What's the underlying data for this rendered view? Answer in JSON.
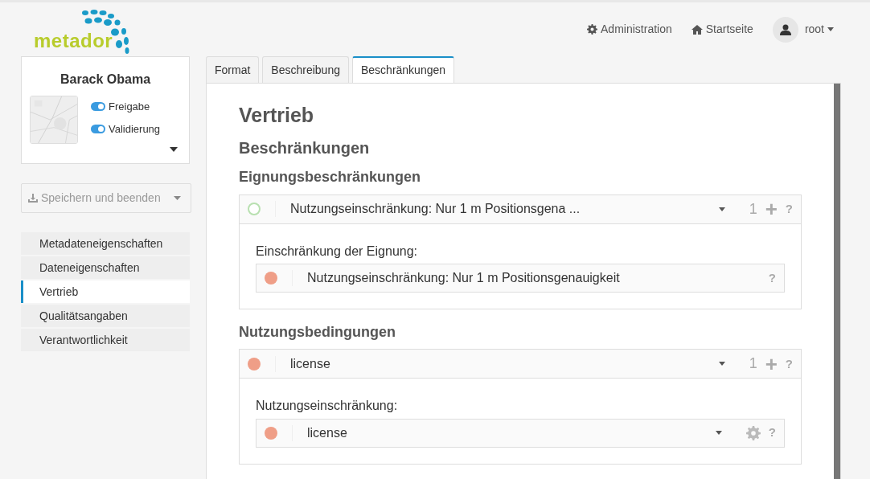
{
  "logo": {
    "text": "metador"
  },
  "topnav": [
    {
      "kind": "gear",
      "label": "Administration"
    },
    {
      "kind": "home",
      "label": "Startseite"
    },
    {
      "kind": "user",
      "label": "root"
    }
  ],
  "record": {
    "title": "Barack Obama",
    "toggles": [
      {
        "label": "Freigabe",
        "on": true
      },
      {
        "label": "Validierung",
        "on": true
      }
    ]
  },
  "save_button": {
    "label": "Speichern und beenden"
  },
  "sidebar": {
    "items": [
      {
        "label": "Metadateneigenschaften",
        "selected": false
      },
      {
        "label": "Dateneigenschaften",
        "selected": false
      },
      {
        "label": "Vertrieb",
        "selected": true
      },
      {
        "label": "Qualitätsangaben",
        "selected": false
      },
      {
        "label": "Verantwortlichkeit",
        "selected": false
      }
    ]
  },
  "tabs": [
    {
      "label": "Format",
      "selected": false
    },
    {
      "label": "Beschreibung",
      "selected": false
    },
    {
      "label": "Beschränkungen",
      "selected": true
    }
  ],
  "page_title": "Vertrieb",
  "section_title": "Beschränkungen",
  "groups": [
    {
      "heading": "Eignungsbeschränkungen",
      "status": {
        "kind": "ring",
        "color": "#b8e0b0"
      },
      "title": "Nutzungseinschränkung: Nur 1 m Positionsgena ...",
      "count": "1",
      "plus": "+",
      "help": "?",
      "field_label": "Einschränkung der Eignung:",
      "field": {
        "kind": "text",
        "status": {
          "kind": "filled",
          "color": "#ef9e87"
        },
        "value": "Nutzungseinschränkung: Nur 1 m Positionsgenauigkeit",
        "help": "?"
      }
    },
    {
      "heading": "Nutzungsbedingungen",
      "status": {
        "kind": "filled",
        "color": "#ef9e87"
      },
      "title": "license",
      "count": "1",
      "plus": "+",
      "help": "?",
      "field_label": "Nutzungseinschränkung:",
      "field": {
        "kind": "select",
        "status": {
          "kind": "filled",
          "color": "#ef9e87"
        },
        "value": "license",
        "help": "?"
      }
    }
  ]
}
